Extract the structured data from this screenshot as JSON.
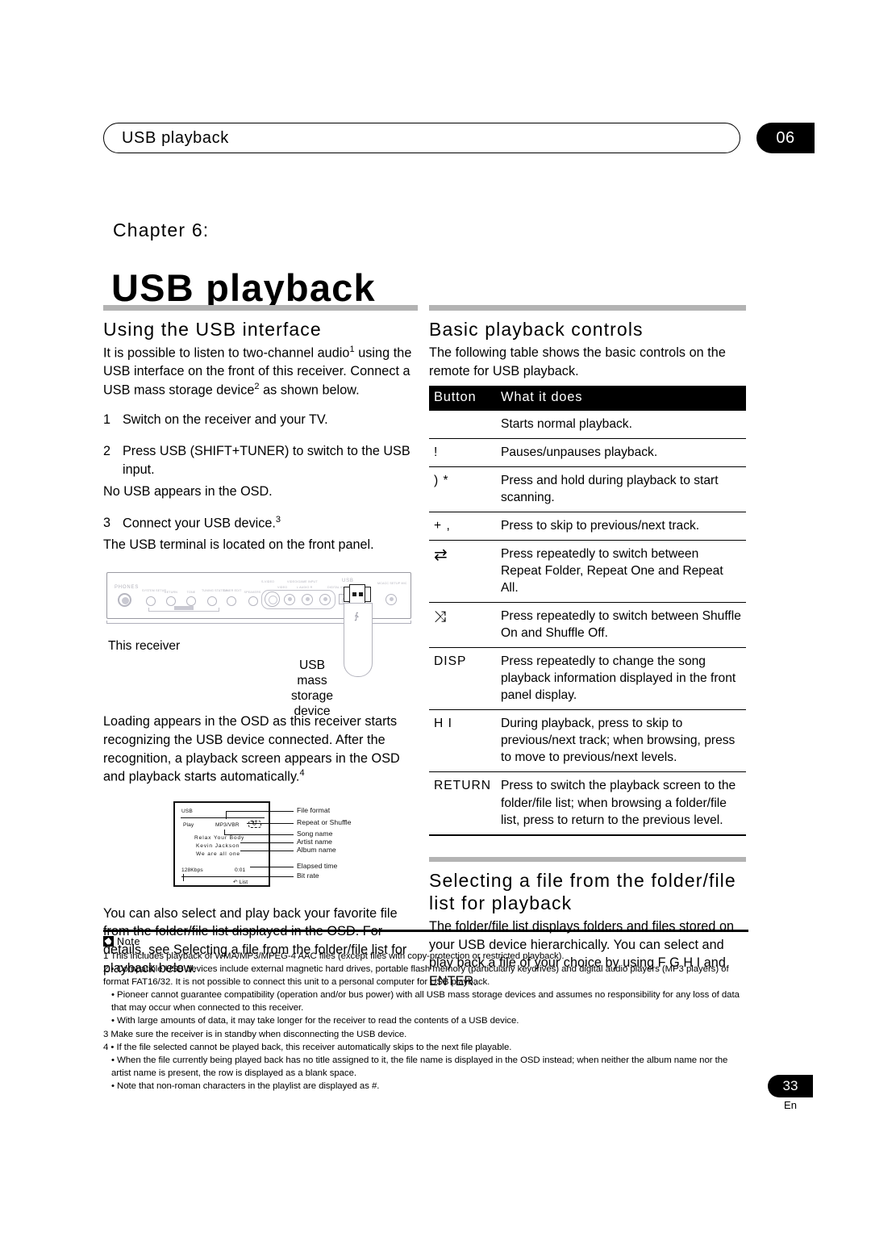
{
  "header": {
    "running_title": "USB playback",
    "chapter_tab": "06"
  },
  "chapter": {
    "kicker": "Chapter 6:",
    "title": "USB playback"
  },
  "left_column": {
    "section1": {
      "heading": "Using the USB interface",
      "intro_a": "It is possible to listen to two-channel audio",
      "intro_a_sup": "1",
      "intro_b": " using the USB interface on the front of this receiver. Connect a USB mass storage device",
      "intro_b_sup": "2",
      "intro_c": " as shown below.",
      "steps": [
        {
          "num": "1",
          "text": "Switch on the receiver and your TV.",
          "extra": ""
        },
        {
          "num": "2",
          "text": "Press USB (SHIFT+TUNER) to switch to the USB input.",
          "extra": "No USB appears in the OSD."
        },
        {
          "num": "3",
          "text": "Connect your USB device.",
          "sup": "3",
          "extra": "The USB terminal is located on the front panel."
        }
      ]
    },
    "receiver_figure": {
      "caption_receiver": "This receiver",
      "caption_usb_line1": "USB mass",
      "caption_usb_line2": "storage device",
      "panel_labels": {
        "phones": "PHONES",
        "system_setup": "SYSTEM SETUP",
        "return": "RETURN",
        "tone": "TONE",
        "tuning_station": "TUNING STATION",
        "tuner_edit": "TUNER EDIT",
        "speakers": "SPEAKERS",
        "multi_jog": "MULTI JOG",
        "s_video": "S-VIDEO",
        "video_game_input": "VIDEO/GAME INPUT",
        "video": "VIDEO",
        "audio_l": "L  AUDIO  R",
        "digital_in": "DIGITAL IN",
        "usb": "USB",
        "mcacc_setup_mic": "MCACC SETUP MIC"
      }
    },
    "loading_text_a": "Loading appears in the OSD as this receiver starts recognizing the USB device connected. After the recognition, a playback screen appears in the OSD and playback starts automatically.",
    "loading_text_sup": "4",
    "osd_figure": {
      "screen": {
        "usb_label": "USB",
        "status": "Play",
        "format": "MP3/VBR",
        "song": "Relax Your Body",
        "artist": "Kevin Jackson",
        "album": "We are all one",
        "bitrate": "128Kbps",
        "time": "0:01",
        "list_label": "List"
      },
      "callouts": [
        "File format",
        "Repeat or Shuffle",
        "Song name",
        "Artist name",
        "Album name",
        "Elapsed time",
        "Bit rate"
      ]
    },
    "closing_text": "You can also select and play back your favorite file from the folder/file list displayed in the OSD. For details, see Selecting a file from the folder/file list for playback below."
  },
  "right_column": {
    "section2": {
      "heading": "Basic playback controls",
      "intro": "The following table shows the basic controls on the remote for USB playback."
    },
    "table": {
      "headers": [
        "Button",
        "What it does"
      ],
      "rows": [
        {
          "button": "",
          "glyph": "",
          "desc": "Starts normal playback."
        },
        {
          "button": "!",
          "glyph": "",
          "desc": "Pauses/unpauses playback."
        },
        {
          "button": ")   *",
          "glyph": "",
          "desc": "Press and hold during playback to start scanning."
        },
        {
          "button": "+   ,",
          "glyph": "",
          "desc": "Press to skip to previous/next track."
        },
        {
          "button": "",
          "glyph": "⇄",
          "desc": "Press repeatedly to switch between Repeat Folder, Repeat One and Repeat All."
        },
        {
          "button": "",
          "glyph": "⤨",
          "desc": "Press repeatedly to switch between Shuffle On and Shuffle Off."
        },
        {
          "button": "DISP",
          "glyph": "",
          "desc": "Press repeatedly to change the song playback information displayed in the front panel display."
        },
        {
          "button": "H    I",
          "glyph": "",
          "desc": "During playback, press to skip to previous/next track; when browsing, press to move to previous/next levels."
        },
        {
          "button": "RETURN",
          "glyph": "",
          "desc": "Press to switch the playback screen to the folder/file list; when browsing a folder/file list, press to return to the previous level."
        }
      ]
    },
    "section3": {
      "heading": "Selecting a file from the folder/file list for playback",
      "body": "The folder/file list displays folders and files stored on your USB device hierarchically. You can select and play back a file of your choice by using  F    G    H    I and ENTER."
    }
  },
  "notes": {
    "label": "Note",
    "lines": [
      {
        "text": "1 This includes playback of WMA/MP3/MPEG-4 AAC files (except files with copy-protection or restricted playback).",
        "indent": false
      },
      {
        "text": "2 • Compatible USB devices include external magnetic hard drives, portable flash memory (particularly keydrives) and digital audio players (MP3 players) of format FAT16/32. It is not possible to connect this unit to a personal computer for USB playback.",
        "indent": false
      },
      {
        "text": "• Pioneer cannot guarantee compatibility (operation and/or bus power) with all USB mass storage devices and assumes no responsibility for any loss of data that may occur when connected to this receiver.",
        "indent": true
      },
      {
        "text": "• With large amounts of data, it may take longer for the receiver to read the contents of a USB device.",
        "indent": true
      },
      {
        "text": "3 Make sure the receiver is in standby when disconnecting the USB device.",
        "indent": false
      },
      {
        "text": "4 • If the file selected cannot be played back, this receiver automatically skips to the next file playable.",
        "indent": false
      },
      {
        "text": "• When the file currently being played back has no title assigned to it, the file name is displayed in the OSD instead; when neither the album name nor the artist name is present, the row is displayed as a blank space.",
        "indent": true
      },
      {
        "text": "• Note that non-roman characters in the playlist are displayed as #.",
        "indent": true
      }
    ]
  },
  "footer": {
    "page_number": "33",
    "language": "En"
  }
}
